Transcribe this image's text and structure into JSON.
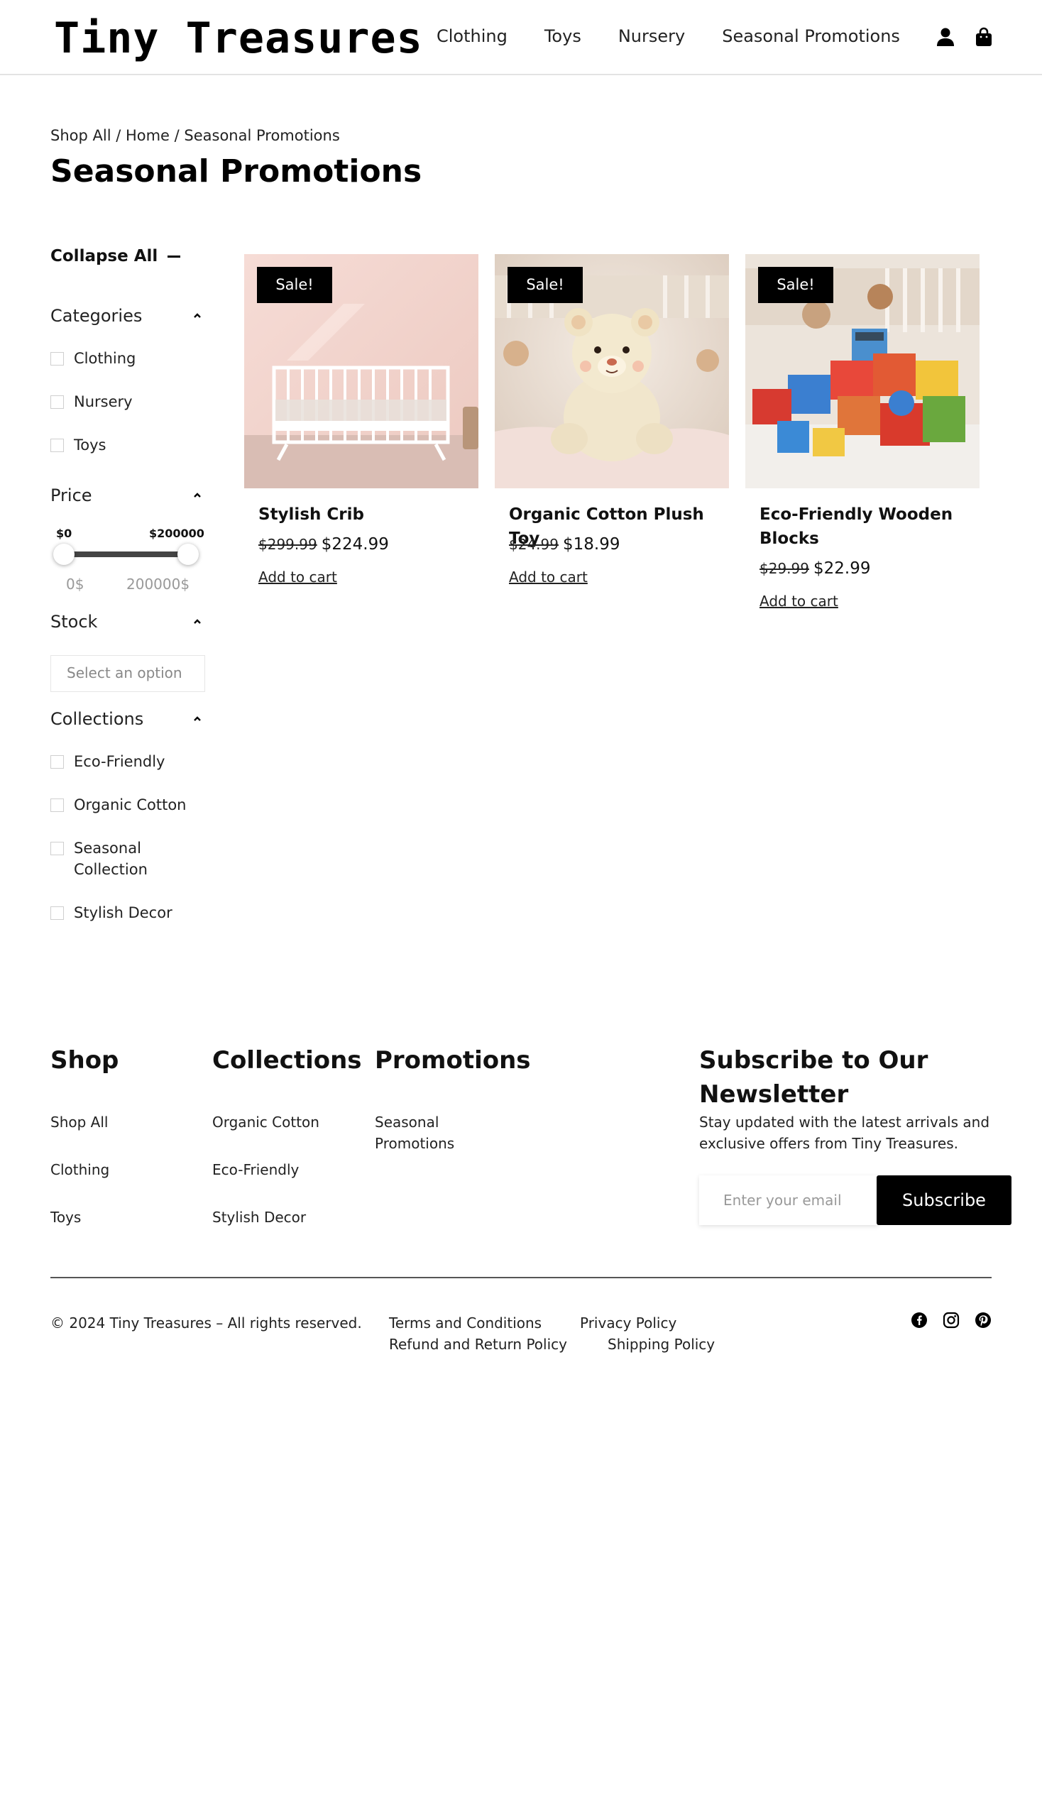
{
  "header": {
    "logo": "Tiny Treasures",
    "nav": [
      "Clothing",
      "Toys",
      "Nursery",
      "Seasonal Promotions"
    ],
    "icons": [
      "user-icon",
      "shopping-bag-icon"
    ]
  },
  "breadcrumb": "Shop All / Home / Seasonal Promotions",
  "page_title": "Seasonal Promotions",
  "sidebar": {
    "collapse_all": "Collapse All",
    "categories": {
      "title": "Categories",
      "items": [
        "Clothing",
        "Nursery",
        "Toys"
      ]
    },
    "price": {
      "title": "Price",
      "min_label": "$0",
      "max_label": "$200000",
      "min_out": "0$",
      "max_out": "200000$",
      "range_min": 0,
      "range_max": 200000
    },
    "stock": {
      "title": "Stock",
      "select_placeholder": "Select an option"
    },
    "collections": {
      "title": "Collections",
      "items": [
        "Eco-Friendly",
        "Organic Cotton",
        "Seasonal Collection",
        "Stylish Decor"
      ]
    }
  },
  "products": [
    {
      "badge": "Sale!",
      "name": "Stylish Crib",
      "old_price": "$299.99",
      "new_price": "$224.99",
      "cta": "Add to cart"
    },
    {
      "badge": "Sale!",
      "name": "Organic Cotton Plush Toy",
      "old_price": "$24.99",
      "new_price": "$18.99",
      "cta": "Add to cart"
    },
    {
      "badge": "Sale!",
      "name": "Eco-Friendly Wooden Blocks",
      "old_price": "$29.99",
      "new_price": "$22.99",
      "cta": "Add to cart"
    }
  ],
  "footer": {
    "shop": {
      "title": "Shop",
      "links": [
        "Shop All",
        "Clothing",
        "Toys"
      ]
    },
    "collections": {
      "title": "Collections",
      "links": [
        "Organic Cotton",
        "Eco-Friendly",
        "Stylish Decor"
      ]
    },
    "promotions": {
      "title": "Promotions",
      "links": [
        "Seasonal Promotions"
      ]
    },
    "newsletter": {
      "title": "Subscribe to Our Newsletter",
      "description": "Stay updated with the latest arrivals and exclusive offers from Tiny Treasures.",
      "placeholder": "Enter your email",
      "button": "Subscribe"
    },
    "copyright": "© 2024 Tiny Treasures – All rights reserved.",
    "policies": [
      "Terms and Conditions",
      "Privacy Policy",
      "Refund and Return Policy",
      "Shipping Policy"
    ],
    "social": [
      "facebook-icon",
      "instagram-icon",
      "pinterest-icon"
    ]
  }
}
